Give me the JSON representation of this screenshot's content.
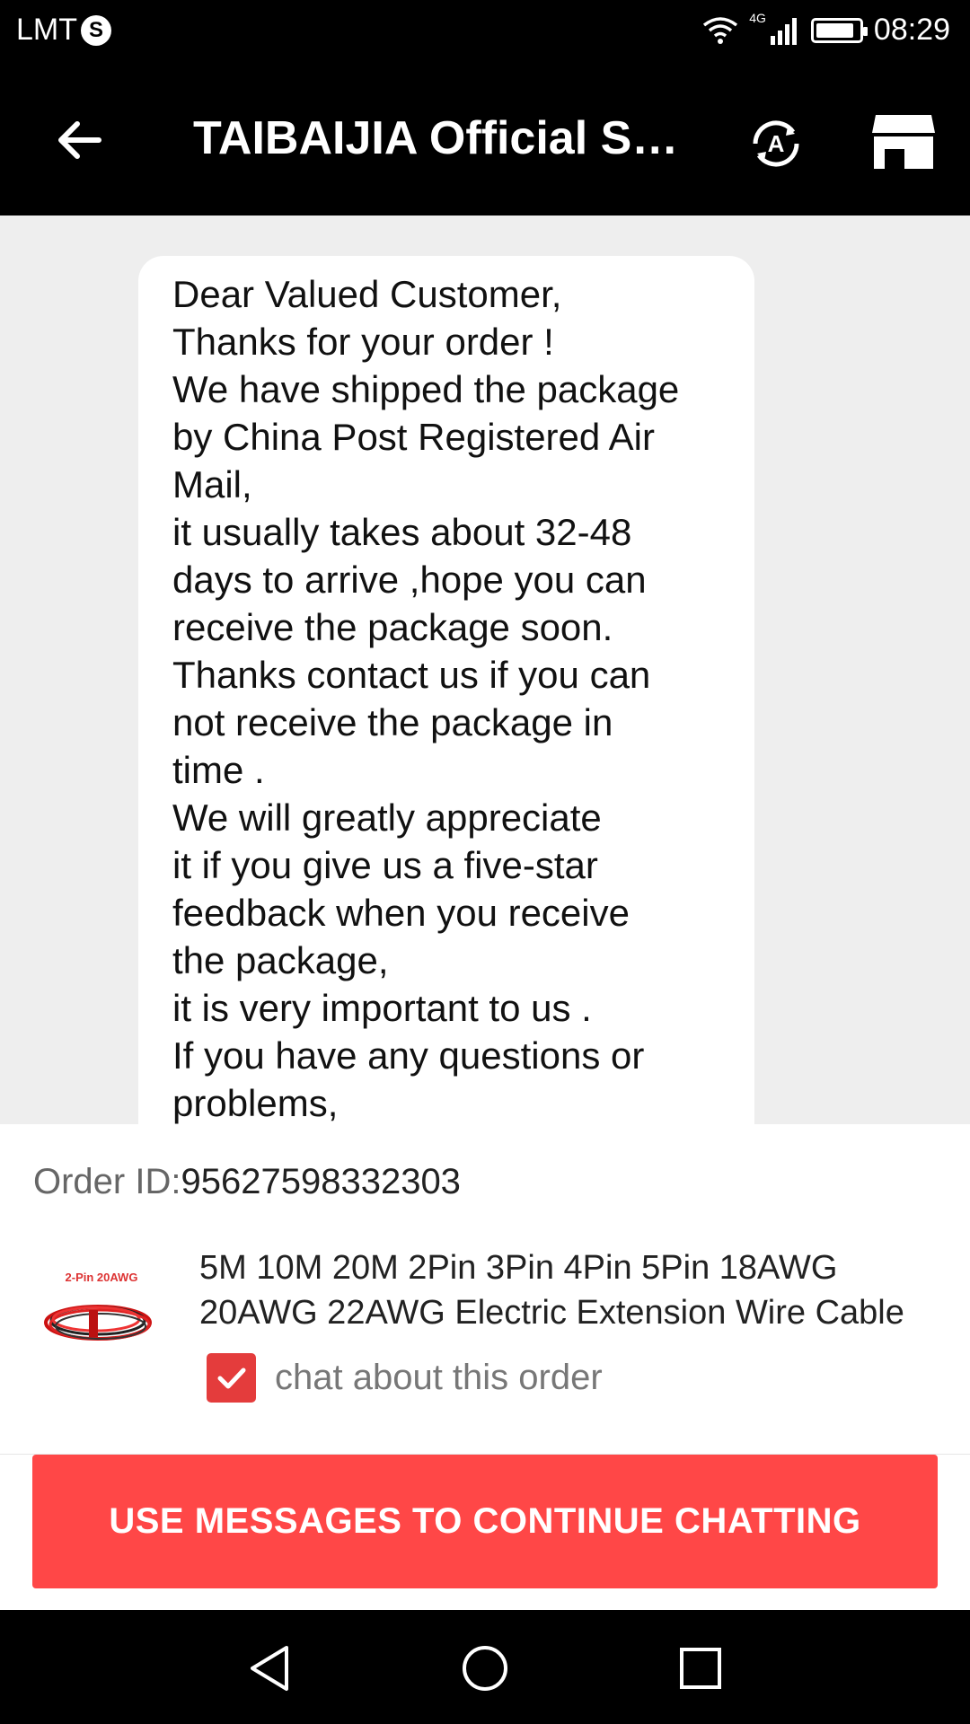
{
  "status_bar": {
    "carrier": "LMT",
    "sim_icon": "S",
    "network": "4G",
    "time": "08:29",
    "battery_level": 0.85
  },
  "header": {
    "title": "TAIBAIJIA Official Store",
    "back_icon": "arrow-left-icon",
    "translate_icon": "translate-icon",
    "store_icon": "store-icon"
  },
  "chat": {
    "message_lines": [
      "Dear Valued Customer,",
      "Thanks for your order !",
      "We have shipped the package",
      "by China Post Registered Air",
      "Mail,",
      "it usually takes about 32-48",
      "days to arrive ,hope you can",
      "receive the package soon.",
      "Thanks contact us if you can",
      "not receive the package in",
      "time .",
      "We will greatly appreciate",
      "it if you give us a five-star",
      "feedback when you receive",
      "the package,",
      "it is very important to us .",
      "If you have any questions or",
      "problems,"
    ]
  },
  "order": {
    "id_label": "Order ID:",
    "id_value": "95627598332303",
    "thumb_label": "2-Pin 20AWG",
    "product_title_line1": "5M 10M 20M 2Pin 3Pin 4Pin 5Pin 18AWG",
    "product_title_line2": "20AWG 22AWG Electric Extension Wire Cable",
    "checkbox_checked": true,
    "checkbox_label": "chat about this order"
  },
  "cta": {
    "label": "USE MESSAGES TO CONTINUE CHATTING"
  },
  "colors": {
    "accent": "#ff4747",
    "checkbox": "#e43c3c",
    "chat_background": "#eeeeee"
  }
}
